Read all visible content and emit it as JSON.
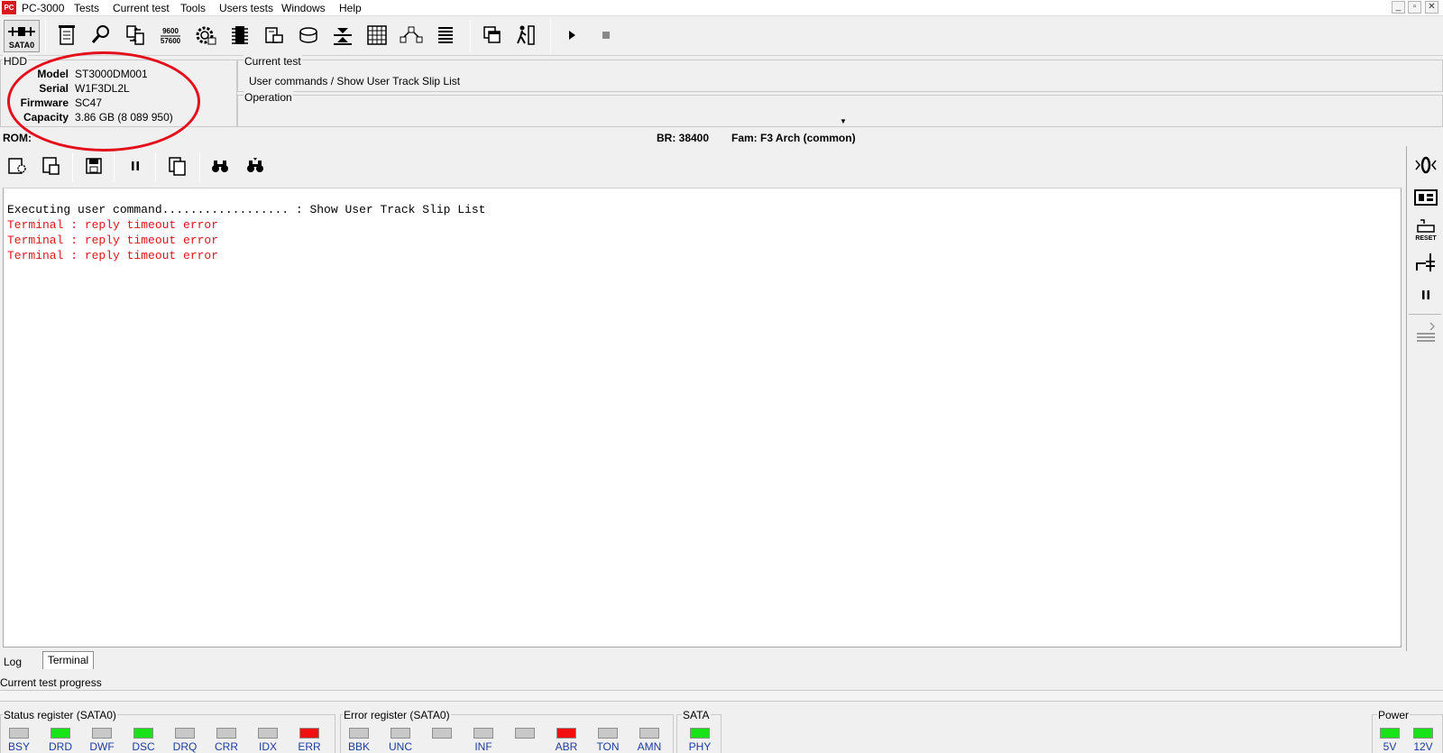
{
  "menu": {
    "items": [
      "PC-3000",
      "Tests",
      "Current test",
      "Tools",
      "Users tests",
      "Windows",
      "Help"
    ]
  },
  "window_controls": {
    "minimize": "_",
    "restore": "▫",
    "close": "✕"
  },
  "toolbar": {
    "sata_label": "SATA0",
    "speed_icon_top": "9600",
    "speed_icon_bottom": "57600"
  },
  "hdd": {
    "title": "HDD",
    "rows": [
      {
        "label": "Model",
        "value": "ST3000DM001"
      },
      {
        "label": "Serial",
        "value": "W1F3DL2L"
      },
      {
        "label": "Firmware",
        "value": "SC47"
      },
      {
        "label": "Capacity",
        "value": "3.86 GB (8 089 950)"
      }
    ]
  },
  "current_test": {
    "title": "Current test",
    "value": "User commands / Show User Track Slip List"
  },
  "operation": {
    "title": "Operation",
    "value": ""
  },
  "status_line": {
    "rom": "ROM:",
    "br": "BR: 38400",
    "fam": "Fam: F3 Arch (common)"
  },
  "log": {
    "lines": [
      {
        "text": "Executing user command.................. : Show User Track Slip List",
        "type": "normal"
      },
      {
        "text": "Terminal : reply timeout error",
        "type": "error"
      },
      {
        "text": "Terminal : reply timeout error",
        "type": "error"
      },
      {
        "text": "Terminal : reply timeout error",
        "type": "error"
      }
    ]
  },
  "sidebar": {
    "reset_label": "RESET"
  },
  "tabs": {
    "log": "Log",
    "terminal": "Terminal"
  },
  "progress": {
    "label": "Current test progress",
    "value": 0
  },
  "status_register": {
    "title": "Status register (SATA0)",
    "leds": [
      {
        "label": "BSY",
        "state": "gray"
      },
      {
        "label": "DRD",
        "state": "green"
      },
      {
        "label": "DWF",
        "state": "gray"
      },
      {
        "label": "DSC",
        "state": "green"
      },
      {
        "label": "DRQ",
        "state": "gray"
      },
      {
        "label": "CRR",
        "state": "gray"
      },
      {
        "label": "IDX",
        "state": "gray"
      },
      {
        "label": "ERR",
        "state": "red"
      }
    ]
  },
  "error_register": {
    "title": "Error register (SATA0)",
    "leds": [
      {
        "label": "BBK",
        "state": "gray"
      },
      {
        "label": "UNC",
        "state": "gray"
      },
      {
        "label": "",
        "state": "gray"
      },
      {
        "label": "INF",
        "state": "gray"
      },
      {
        "label": "",
        "state": "gray"
      },
      {
        "label": "ABR",
        "state": "red"
      },
      {
        "label": "TON",
        "state": "gray"
      },
      {
        "label": "AMN",
        "state": "gray"
      }
    ]
  },
  "sata": {
    "title": "SATA",
    "leds": [
      {
        "label": "PHY",
        "state": "green"
      }
    ]
  },
  "power": {
    "title": "Power",
    "leds": [
      {
        "label": "5V",
        "state": "green"
      },
      {
        "label": "12V",
        "state": "green"
      }
    ]
  },
  "colors": {
    "error_text": "#e1141c",
    "led_green": "#18e218",
    "led_red": "#f01010",
    "annotation": "#e3101c"
  }
}
